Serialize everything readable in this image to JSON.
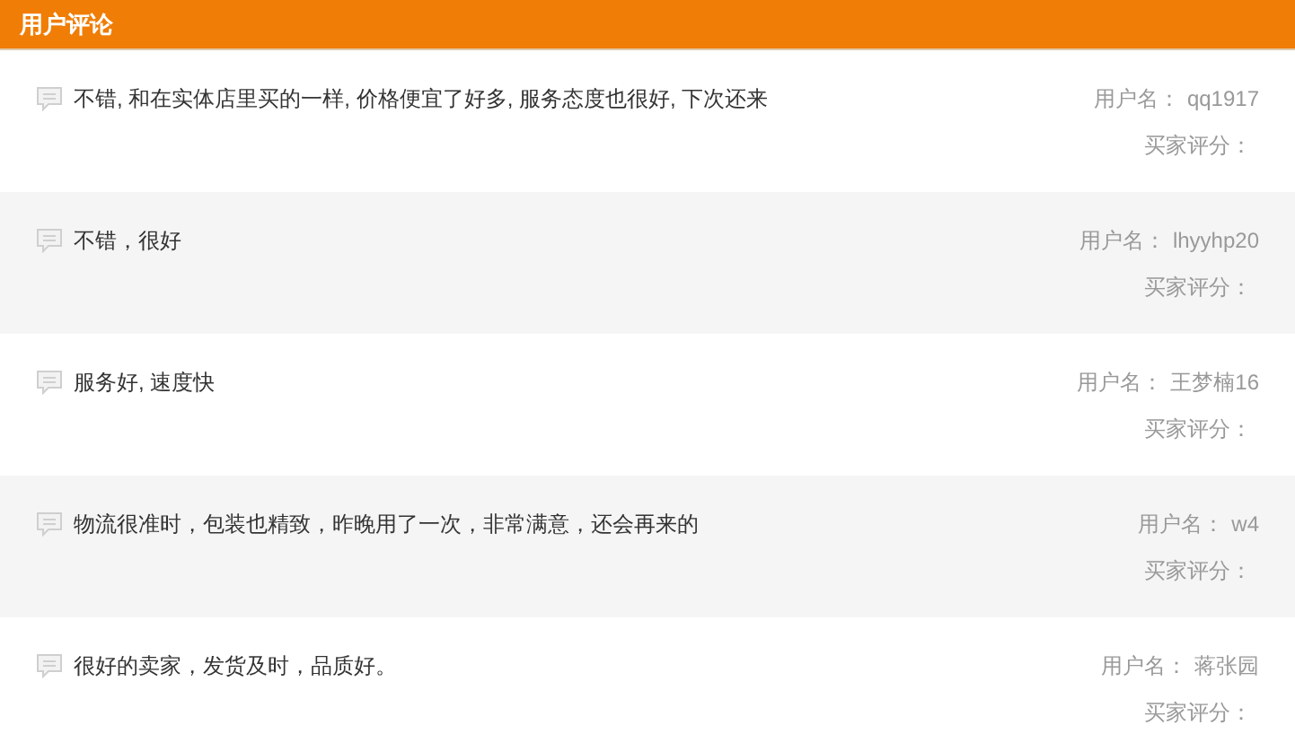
{
  "header": {
    "title": "用户评论"
  },
  "reviews": [
    {
      "comment": "不错, 和在实体店里买的一样, 价格便宜了好多, 服务态度也很好, 下次还来",
      "user_label": "用户名：",
      "user": "qq1917",
      "rating_label": "买家评分："
    },
    {
      "comment": "不错，很好",
      "user_label": "用户名：",
      "user": "lhyyhp20",
      "rating_label": "买家评分："
    },
    {
      "comment": "服务好, 速度快",
      "user_label": "用户名：",
      "user": "王梦楠16",
      "rating_label": "买家评分："
    },
    {
      "comment": "物流很准时，包装也精致，昨晚用了一次，非常满意，还会再来的",
      "user_label": "用户名：",
      "user": "w4",
      "rating_label": "买家评分："
    },
    {
      "comment": "很好的卖家，发货及时，品质好。",
      "user_label": "用户名：",
      "user": "蒋张园",
      "rating_label": "买家评分："
    }
  ]
}
